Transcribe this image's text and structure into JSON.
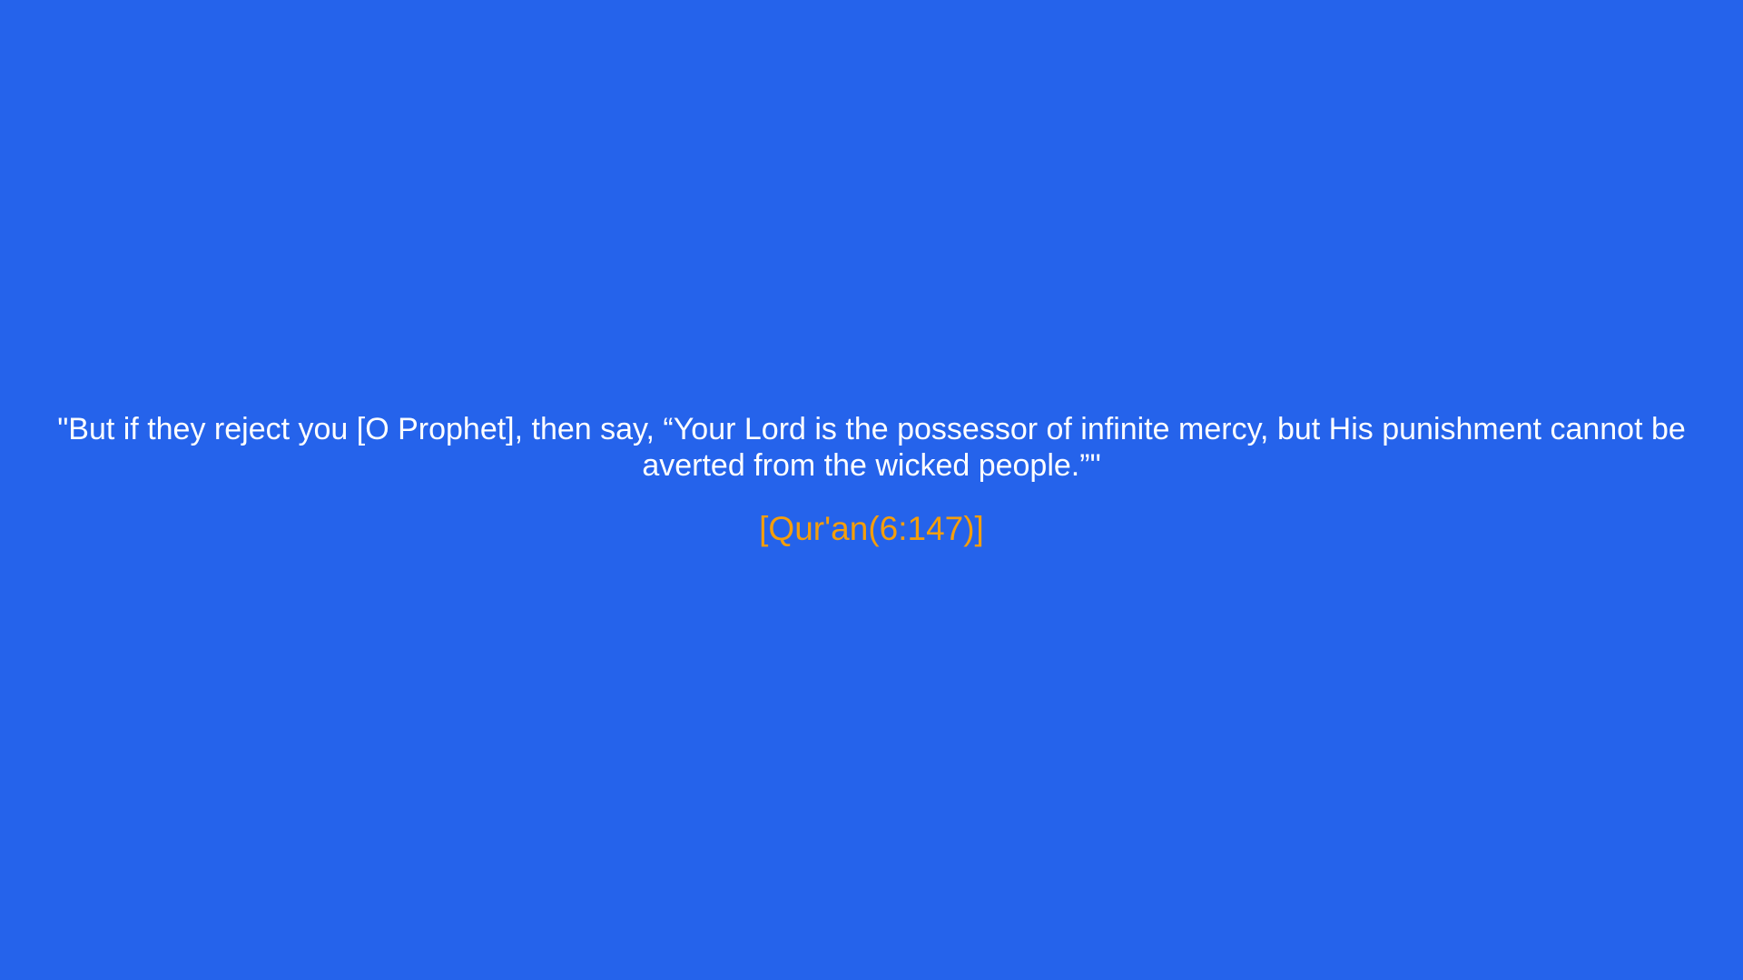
{
  "quote": {
    "text": "\"But if they reject you [O Prophet], then say, “Your Lord is the possessor of infinite mercy, but His punishment cannot be averted from the wicked people.”\"",
    "reference": "[Qur'an(6:147)]"
  },
  "colors": {
    "background": "#2563EB",
    "quote_text": "#FFFFFF",
    "reference_text": "#F59E0B"
  }
}
